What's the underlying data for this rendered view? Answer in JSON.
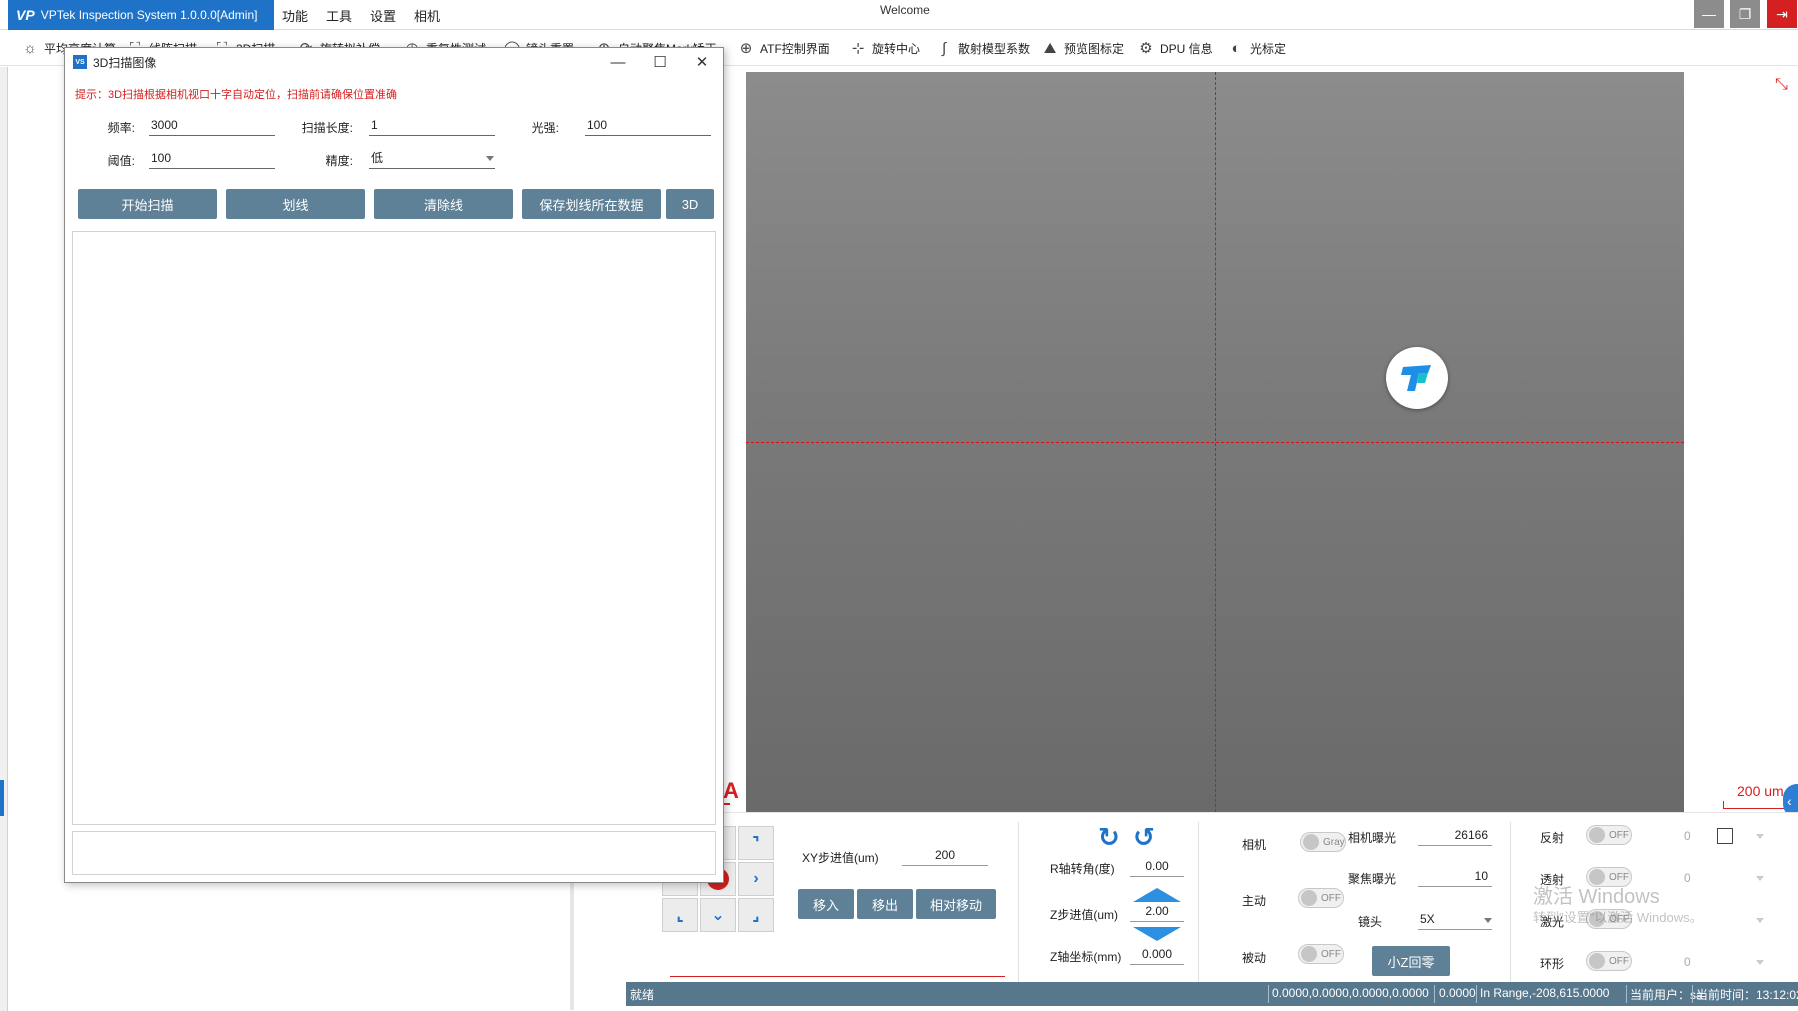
{
  "titlebar": {
    "app_title": "VPTek Inspection System 1.0.0.0[Admin]",
    "logo_text": "VP",
    "menu": [
      "功能",
      "工具",
      "设置",
      "相机"
    ],
    "welcome": "Welcome"
  },
  "toolbar": {
    "items": [
      {
        "label": "平均亮度计算",
        "icon": "bulb-icon"
      },
      {
        "label": "线阵扫描",
        "icon": "scan-icon"
      },
      {
        "label": "3D扫描",
        "icon": "scan-3d-icon"
      },
      {
        "label": "旋转拟补偿",
        "icon": "rotate-icon"
      },
      {
        "label": "重复性测试",
        "icon": "repeat-icon"
      },
      {
        "label": "镜头重置",
        "icon": "lens-icon"
      },
      {
        "label": "自动聚焦Mark矫正",
        "icon": "focus-icon"
      },
      {
        "label": "ATF控制界面",
        "icon": "crosshair-icon"
      },
      {
        "label": "旋转中心",
        "icon": "rotation-center-icon"
      },
      {
        "label": "散射模型系数",
        "icon": "curve-icon"
      },
      {
        "label": "预览图标定",
        "icon": "image-calibrate-icon"
      },
      {
        "label": "DPU 信息",
        "icon": "gear-icon"
      },
      {
        "label": "光标定",
        "icon": "light-icon"
      }
    ]
  },
  "dialog": {
    "title": "3D扫描图像",
    "icon_text": "VS",
    "hint": "提示：3D扫描根据相机视口十字自动定位，扫描前请确保位置准确",
    "fields": {
      "frequency_label": "频率:",
      "frequency_value": "3000",
      "scan_length_label": "扫描长度:",
      "scan_length_value": "1",
      "light_label": "光强:",
      "light_value": "100",
      "threshold_label": "阈值:",
      "threshold_value": "100",
      "precision_label": "精度:",
      "precision_value": "低"
    },
    "buttons": {
      "start_scan": "开始扫描",
      "draw_line": "划线",
      "clear_line": "清除线",
      "save_line_data": "保存划线所在数据",
      "three_d": "3D"
    }
  },
  "camera": {
    "scale_label": "200 um",
    "marker_letter": "A"
  },
  "controls": {
    "xy_step_label": "XY步进值(um)",
    "xy_step_value": "200",
    "move_in": "移入",
    "move_out": "移出",
    "relative_move": "相对移动",
    "r_angle_label": "R轴转角(度)",
    "r_angle_value": "0.00",
    "z_step_label": "Z步进值(um)",
    "z_step_value": "2.00",
    "z_coord_label": "Z轴坐标(mm)",
    "z_coord_value": "0.000",
    "camera_label": "相机",
    "camera_toggle": "Gray",
    "active_label": "主动",
    "active_toggle": "OFF",
    "passive_label": "被动",
    "passive_toggle": "OFF",
    "camera_exposure_label": "相机曝光",
    "camera_exposure_value": "26166",
    "focus_exposure_label": "聚焦曝光",
    "focus_exposure_value": "10",
    "lens_label": "镜头",
    "lens_value": "5X",
    "small_z_home": "小Z回零",
    "reflect_label": "反射",
    "reflect_toggle": "OFF",
    "reflect_value": "0",
    "transmit_label": "透射",
    "transmit_toggle": "OFF",
    "transmit_value": "0",
    "laser_label": "激光",
    "laser_toggle": "OFF",
    "ring_label": "环形",
    "ring_toggle": "OFF",
    "ring_value": "0"
  },
  "watermark": {
    "line1": "激活 Windows",
    "line2": "转到\"设置\"以激活 Windows。"
  },
  "statusbar": {
    "status": "就绪",
    "coords": "0.0000,0.0000,0.0000,0.0000",
    "value": "0.0000",
    "range": "In Range,-208,615.0000",
    "user": "当前用户：sa",
    "time": "当前时间：13:12:02"
  },
  "colors": {
    "accent": "#1e73c8",
    "button": "#5e8198",
    "statusbar": "#56778c",
    "crosshair": "#e01010",
    "hint": "#d42020"
  }
}
